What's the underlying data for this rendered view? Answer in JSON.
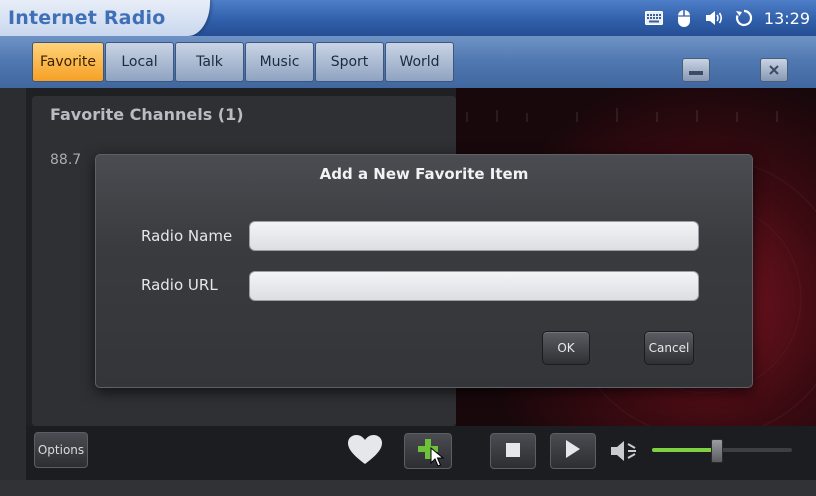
{
  "app": {
    "title": "Internet Radio"
  },
  "tray": {
    "time": "13:29",
    "icons": [
      "keyboard-icon",
      "mouse-icon",
      "speaker-icon",
      "sync-icon"
    ]
  },
  "tabs": [
    {
      "label": "Favorite",
      "active": true
    },
    {
      "label": "Local"
    },
    {
      "label": "Talk"
    },
    {
      "label": "Music"
    },
    {
      "label": "Sport"
    },
    {
      "label": "World"
    }
  ],
  "window_buttons": {
    "minimize_icon": "minimize-icon",
    "close_icon": "close-icon"
  },
  "list": {
    "title": "Favorite Channels (1)",
    "items": [
      {
        "label": "88.7"
      }
    ]
  },
  "dialog": {
    "title": "Add a New Favorite Item",
    "name_label": "Radio Name",
    "name_value": "",
    "url_label": "Radio URL",
    "url_value": "",
    "ok_label": "OK",
    "cancel_label": "Cancel"
  },
  "controls": {
    "options_label": "Options",
    "icons": [
      "heart-icon",
      "add-icon",
      "stop-icon",
      "play-icon",
      "mute-icon"
    ],
    "volume": 0.46
  },
  "colors": {
    "accent_tab": "#f6a025",
    "title_bar": "#2f5da8",
    "volume_fill": "#7fd141"
  }
}
